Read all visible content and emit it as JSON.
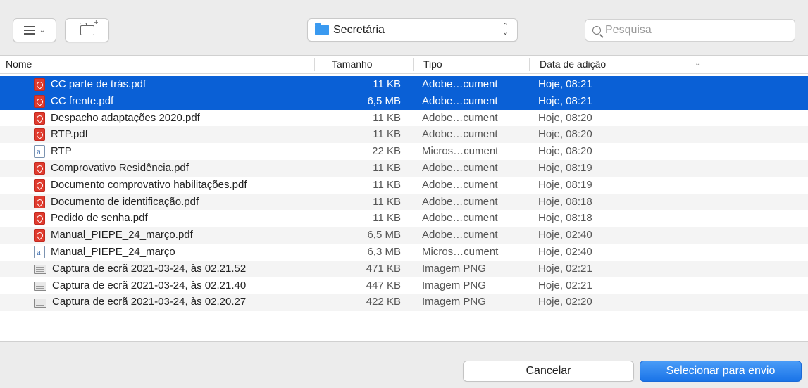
{
  "toolbar": {
    "view_icon": "list-view-icon",
    "new_folder_icon": "new-folder-icon",
    "location": {
      "label": "Secretária",
      "icon": "folder-icon"
    },
    "search": {
      "placeholder": "Pesquisa",
      "value": ""
    }
  },
  "columns": {
    "name": "Nome",
    "size": "Tamanho",
    "type": "Tipo",
    "date": "Data de adição"
  },
  "files": [
    {
      "name": "CC parte de trás.pdf",
      "size": "11 KB",
      "type": "Adobe…cument",
      "date": "Hoje, 08:21",
      "kind": "pdf",
      "selected": true
    },
    {
      "name": "CC frente.pdf",
      "size": "6,5 MB",
      "type": "Adobe…cument",
      "date": "Hoje, 08:21",
      "kind": "pdf",
      "selected": true
    },
    {
      "name": "Despacho adaptações 2020.pdf",
      "size": "11 KB",
      "type": "Adobe…cument",
      "date": "Hoje, 08:20",
      "kind": "pdf",
      "selected": false
    },
    {
      "name": "RTP.pdf",
      "size": "11 KB",
      "type": "Adobe…cument",
      "date": "Hoje, 08:20",
      "kind": "pdf",
      "selected": false
    },
    {
      "name": "RTP",
      "size": "22 KB",
      "type": "Micros…cument",
      "date": "Hoje, 08:20",
      "kind": "doc",
      "selected": false
    },
    {
      "name": "Comprovativo Residência.pdf",
      "size": "11 KB",
      "type": "Adobe…cument",
      "date": "Hoje, 08:19",
      "kind": "pdf",
      "selected": false
    },
    {
      "name": "Documento comprovativo habilitações.pdf",
      "size": "11 KB",
      "type": "Adobe…cument",
      "date": "Hoje, 08:19",
      "kind": "pdf",
      "selected": false
    },
    {
      "name": "Documento de identificação.pdf",
      "size": "11 KB",
      "type": "Adobe…cument",
      "date": "Hoje, 08:18",
      "kind": "pdf",
      "selected": false
    },
    {
      "name": "Pedido de senha.pdf",
      "size": "11 KB",
      "type": "Adobe…cument",
      "date": "Hoje, 08:18",
      "kind": "pdf",
      "selected": false
    },
    {
      "name": "Manual_PIEPE_24_março.pdf",
      "size": "6,5 MB",
      "type": "Adobe…cument",
      "date": "Hoje, 02:40",
      "kind": "pdf",
      "selected": false
    },
    {
      "name": "Manual_PIEPE_24_março",
      "size": "6,3 MB",
      "type": "Micros…cument",
      "date": "Hoje, 02:40",
      "kind": "doc",
      "selected": false
    },
    {
      "name": "Captura de ecrã 2021-03-24, às 02.21.52",
      "size": "471 KB",
      "type": "Imagem PNG",
      "date": "Hoje, 02:21",
      "kind": "image",
      "selected": false
    },
    {
      "name": "Captura de ecrã 2021-03-24, às 02.21.40",
      "size": "447 KB",
      "type": "Imagem PNG",
      "date": "Hoje, 02:21",
      "kind": "image",
      "selected": false
    },
    {
      "name": "Captura de ecrã 2021-03-24, às 02.20.27",
      "size": "422 KB",
      "type": "Imagem PNG",
      "date": "Hoje, 02:20",
      "kind": "image",
      "selected": false
    }
  ],
  "buttons": {
    "cancel": "Cancelar",
    "confirm": "Selecionar para envio"
  },
  "colors": {
    "selection": "#0a60d6",
    "primary_button": "#1a74e8",
    "pdf_icon": "#e03b2e",
    "folder": "#3a9af0"
  }
}
